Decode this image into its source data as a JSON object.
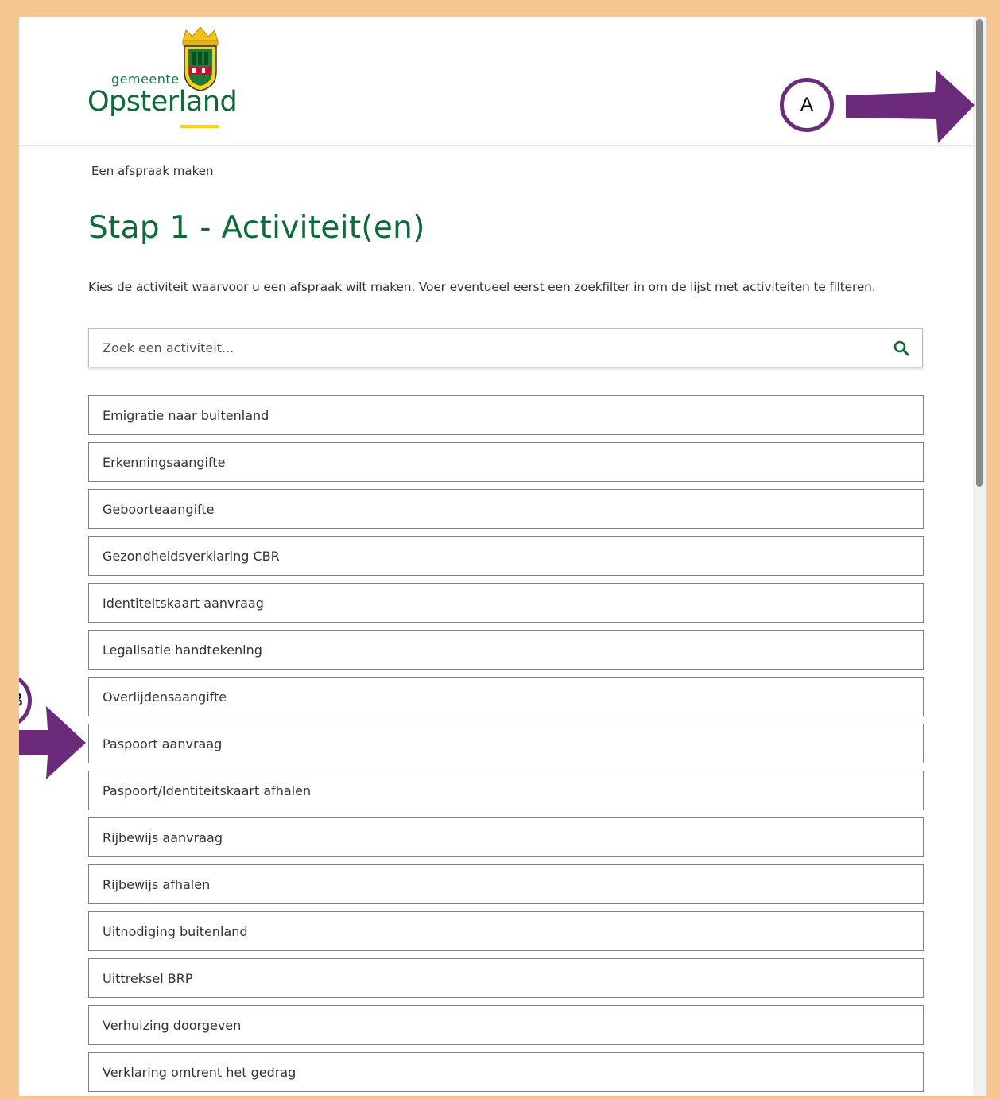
{
  "header": {
    "logo_small": "gemeente",
    "logo_big": "Opsterland"
  },
  "breadcrumb": "Een afspraak maken",
  "page_title": "Stap 1 - Activiteit(en)",
  "intro": "Kies de activiteit waarvoor u een afspraak wilt maken. Voer eventueel eerst een zoekfilter in om de lijst met activiteiten te filteren.",
  "search": {
    "placeholder": "Zoek een activiteit...",
    "value": ""
  },
  "activities": [
    "Emigratie naar buitenland",
    "Erkenningsaangifte",
    "Geboorteaangifte",
    "Gezondheidsverklaring CBR",
    "Identiteitskaart aanvraag",
    "Legalisatie handtekening",
    "Overlijdensaangifte",
    "Paspoort aanvraag",
    "Paspoort/Identiteitskaart afhalen",
    "Rijbewijs aanvraag",
    "Rijbewijs afhalen",
    "Uitnodiging buitenland",
    "Uittreksel BRP",
    "Verhuizing doorgeven",
    "Verklaring omtrent het gedrag"
  ],
  "annotations": {
    "marker_a": "A",
    "marker_b": "B"
  },
  "colors": {
    "brand_green": "#0e6b35",
    "accent_yellow": "#f7d319",
    "annotation_purple": "#6b2b7a",
    "frame_orange": "#f6c690"
  }
}
